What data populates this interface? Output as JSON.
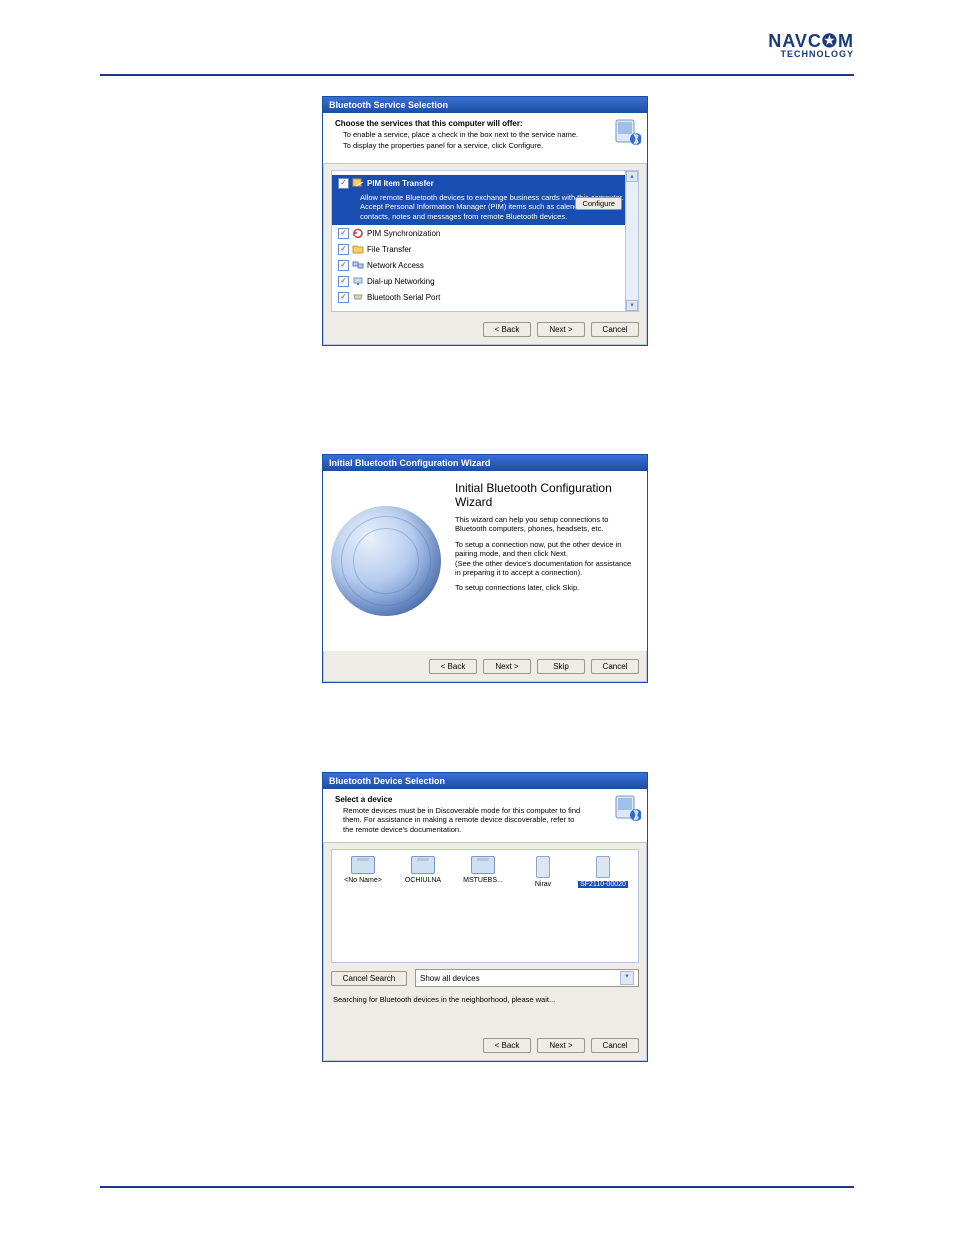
{
  "logo": {
    "main": "NAVC✪M",
    "sub": "TECHNOLOGY"
  },
  "dialog1": {
    "title": "Bluetooth Service Selection",
    "heading": "Choose the services that this computer will offer:",
    "sub1": "To enable a service, place a check in the box next to the service name.",
    "sub2": "To display the properties panel for a service, click Configure.",
    "highlight": {
      "name": "PIM Item Transfer",
      "desc": "Allow remote Bluetooth devices to exchange business cards with this computer. Accept Personal Information Manager (PIM) items such as calendar items, contacts, notes and messages from remote Bluetooth devices.",
      "configure": "Configure"
    },
    "services": [
      {
        "name": "PIM Synchronization"
      },
      {
        "name": "File Transfer"
      },
      {
        "name": "Network Access"
      },
      {
        "name": "Dial-up Networking"
      },
      {
        "name": "Bluetooth Serial Port"
      }
    ],
    "buttons": {
      "back": "< Back",
      "next": "Next >",
      "cancel": "Cancel"
    }
  },
  "dialog2": {
    "title": "Initial Bluetooth Configuration Wizard",
    "heading": "Initial Bluetooth Configuration Wizard",
    "p1": "This wizard can help you setup connections to Bluetooth computers, phones, headsets, etc.",
    "p2": "To setup a connection now, put the other device in pairing mode, and then click Next.\n(See the other device's documentation for assistance in preparing it to accept a connection).",
    "p3": "To setup connections later, click Skip.",
    "buttons": {
      "back": "< Back",
      "next": "Next >",
      "skip": "Skip",
      "cancel": "Cancel"
    }
  },
  "dialog3": {
    "title": "Bluetooth Device Selection",
    "heading": "Select a device",
    "sub": "Remote devices must be in Discoverable mode for this computer to find them. For assistance in making a remote device discoverable, refer to the remote device's documentation.",
    "devices": [
      {
        "name": "<No Name>",
        "type": "pc"
      },
      {
        "name": "OCHIULNA",
        "type": "pc"
      },
      {
        "name": "MSTUEBS...",
        "type": "pc"
      },
      {
        "name": "Nirav",
        "type": "pda"
      },
      {
        "name": "SF2110-00020",
        "type": "pda",
        "selected": true
      }
    ],
    "cancel_search": "Cancel Search",
    "filter": "Show all devices",
    "status": "Searching for Bluetooth devices in the neighborhood, please wait...",
    "buttons": {
      "back": "< Back",
      "next": "Next >",
      "cancel": "Cancel"
    }
  }
}
